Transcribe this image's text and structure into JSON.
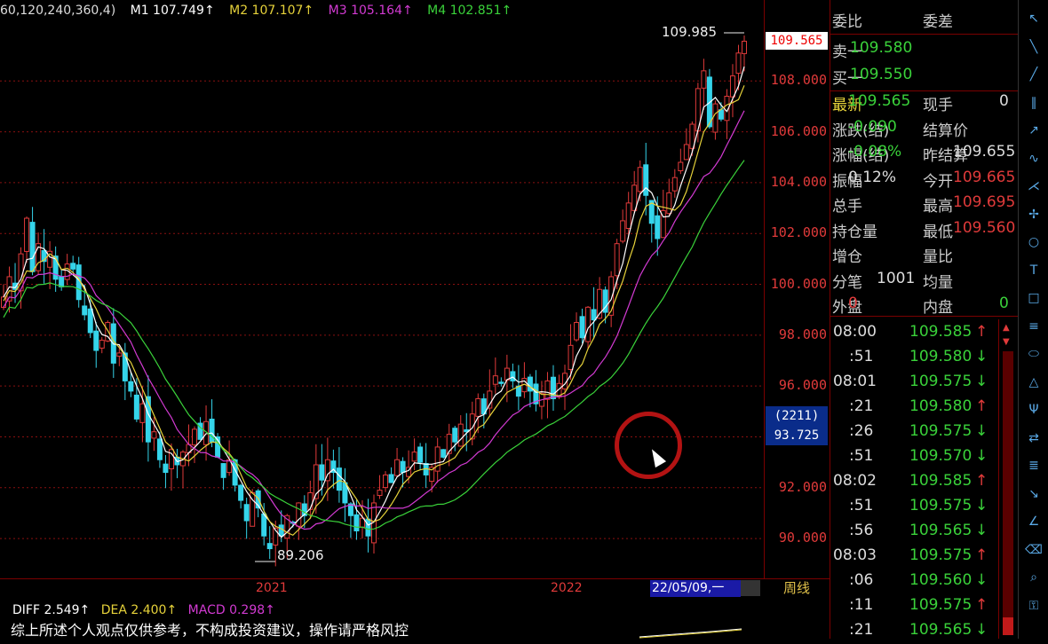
{
  "ma_legend": {
    "params": "60,120,240,360,4)",
    "m1": "M1 107.749↑",
    "m2": "M2 107.107↑",
    "m3": "M3 105.164↑",
    "m4": "M4 102.851↑"
  },
  "colors": {
    "m1": "#ffffff",
    "m2": "#e6d23a",
    "m3": "#d23ad2",
    "m4": "#3ad23a",
    "up": "#e03a3a",
    "down": "#35d4ea",
    "grid": "#8a1010"
  },
  "y_axis": {
    "labels": [
      "108.000",
      "106.000",
      "104.000",
      "102.000",
      "100.000",
      "98.000",
      "96.000",
      "94.000",
      "92.000",
      "90.000"
    ],
    "current_price": "109.565",
    "cursor_count": "(2211)",
    "cursor_price": "93.725"
  },
  "annotations": {
    "high": "109.985",
    "low": "89.206"
  },
  "time_axis": {
    "labels": [
      "2021",
      "2022"
    ],
    "cursor_date": "22/05/09,一",
    "period": "周线"
  },
  "macd": {
    "diff": "DIFF 2.549↑",
    "dea": "DEA 2.400↑",
    "macd": "MACD 0.298↑"
  },
  "caption": "综上所述个人观点仅供参考，不构成投资建议，操作请严格风控",
  "quote": {
    "header_left": "委比",
    "header_right": "委差",
    "sell_label": "卖一",
    "sell_value": "109.580",
    "buy_label": "买一",
    "buy_value": "109.550",
    "rows": [
      {
        "l1": "最新",
        "v1": "109.565",
        "l2": "现手",
        "v2": "0"
      },
      {
        "l1": "涨跌(结)",
        "v1": "-0.090",
        "l2": "结算价",
        "v2": ""
      },
      {
        "l1": "涨幅(结)",
        "v1": "-0.08%",
        "l2": "昨结算",
        "v2": "109.655"
      },
      {
        "l1": "振幅",
        "v1": "0.12%",
        "l2": "今开",
        "v2": "109.665"
      },
      {
        "l1": "总手",
        "v1": "",
        "l2": "最高",
        "v2": "109.695"
      },
      {
        "l1": "持仓量",
        "v1": "",
        "l2": "最低",
        "v2": "109.560"
      },
      {
        "l1": "增仓",
        "v1": "",
        "l2": "量比",
        "v2": ""
      },
      {
        "l1": "分笔",
        "v1": "1001",
        "l2": "均量",
        "v2": ""
      },
      {
        "l1": "外盘",
        "v1": "0",
        "l2": "内盘",
        "v2": "0"
      }
    ]
  },
  "trades": [
    {
      "time": "08:00",
      "price": "109.585",
      "dir": "↑"
    },
    {
      "time": ":51",
      "price": "109.580",
      "dir": "↓"
    },
    {
      "time": "08:01",
      "price": "109.575",
      "dir": "↓"
    },
    {
      "time": ":21",
      "price": "109.580",
      "dir": "↑"
    },
    {
      "time": ":26",
      "price": "109.575",
      "dir": "↓"
    },
    {
      "time": ":51",
      "price": "109.570",
      "dir": "↓"
    },
    {
      "time": "08:02",
      "price": "109.585",
      "dir": "↑"
    },
    {
      "time": ":51",
      "price": "109.575",
      "dir": "↓"
    },
    {
      "time": ":56",
      "price": "109.565",
      "dir": "↓"
    },
    {
      "time": "08:03",
      "price": "109.575",
      "dir": "↑"
    },
    {
      "time": ":06",
      "price": "109.560",
      "dir": "↓"
    },
    {
      "time": ":11",
      "price": "109.575",
      "dir": "↑"
    },
    {
      "time": ":21",
      "price": "109.565",
      "dir": "↓"
    }
  ],
  "toolbar_icons": [
    "cursor-icon",
    "line-icon",
    "ray-icon",
    "parallel-icon",
    "arrow-icon",
    "wave-icon",
    "fork-icon",
    "gann-icon",
    "cycle-icon",
    "text-icon",
    "box-icon",
    "fib-icon",
    "ellipse-icon",
    "triangle-icon",
    "pitchfork-icon",
    "channel-icon",
    "fib-time-icon",
    "speed-icon",
    "angle-icon",
    "eraser-icon",
    "zoom-icon",
    "lock-icon"
  ],
  "chart_data": {
    "type": "candlestick",
    "y_min": 89.2,
    "y_max": 110.0,
    "high_label": "109.985",
    "low_label": "89.206",
    "close_series": [
      99.5,
      100.3,
      99.8,
      101.2,
      102.6,
      100.5,
      101.6,
      100.9,
      101.3,
      100.2,
      99.9,
      100.8,
      100.6,
      99.4,
      98.8,
      98.1,
      97.4,
      97.8,
      98.5,
      96.9,
      97.3,
      96.2,
      95.8,
      94.7,
      95.3,
      93.8,
      94.2,
      93.1,
      92.6,
      93.5,
      92.9,
      93.4,
      93.7,
      94.3,
      93.9,
      94.6,
      93.8,
      93.2,
      92.4,
      93.1,
      92.1,
      91.5,
      90.7,
      91.8,
      91.2,
      90.1,
      89.6,
      90.4,
      90.1,
      90.9,
      90.6,
      91.4,
      90.9,
      91.8,
      92.9,
      92.3,
      93.1,
      92.6,
      91.9,
      91.4,
      90.9,
      90.3,
      90.8,
      90.1,
      91.4,
      91.9,
      92.5,
      92.2,
      93.1,
      92.6,
      92.8,
      93.4,
      93.0,
      92.5,
      92.8,
      93.6,
      93.2,
      94.1,
      93.8,
      94.5,
      94.2,
      94.9,
      95.5,
      94.9,
      95.8,
      96.4,
      96.1,
      96.7,
      96.2,
      95.6,
      96.3,
      95.8,
      95.3,
      95.7,
      96.2,
      95.5,
      96.1,
      96.5,
      97.6,
      98.5,
      97.9,
      99.1,
      98.6,
      99.8,
      98.9,
      100.3,
      101.6,
      102.5,
      103.2,
      103.9,
      104.6,
      103.5,
      102.4,
      101.8,
      102.9,
      103.6,
      104.2,
      104.8,
      105.5,
      106.3,
      107.7,
      108.4,
      106.2,
      107.1,
      106.5,
      107.4,
      108.2,
      109.1,
      109.565
    ],
    "m1_last": 107.749,
    "m2_last": 107.107,
    "m3_last": 105.164,
    "m4_last": 102.851
  }
}
